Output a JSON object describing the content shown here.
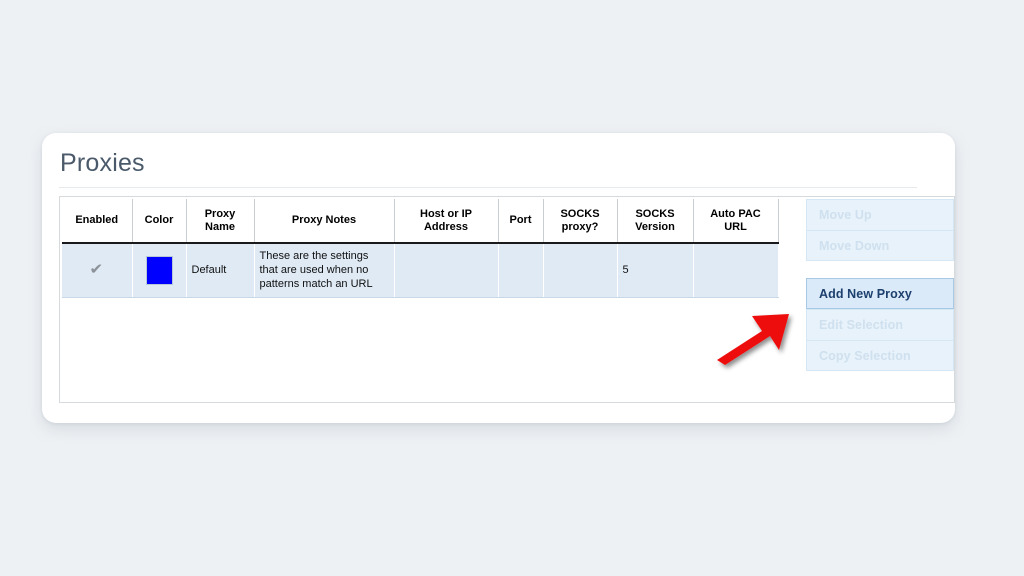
{
  "page": {
    "background_color": "#eef1f4",
    "card_background": "#ffffff"
  },
  "header": {
    "title": "Proxies",
    "title_color": "#4b5a6b"
  },
  "table": {
    "columns": [
      {
        "key": "enabled",
        "label": "Enabled"
      },
      {
        "key": "color",
        "label": "Color"
      },
      {
        "key": "name",
        "label": "Proxy\nName",
        "line1": "Proxy",
        "line2": "Name"
      },
      {
        "key": "notes",
        "label": "Proxy Notes"
      },
      {
        "key": "host",
        "label": "Host or IP\nAddress",
        "line1": "Host or IP",
        "line2": "Address"
      },
      {
        "key": "port",
        "label": "Port"
      },
      {
        "key": "socks",
        "label": "SOCKS\nproxy?",
        "line1": "SOCKS",
        "line2": "proxy?"
      },
      {
        "key": "socksver",
        "label": "SOCKS\nVersion",
        "line1": "SOCKS",
        "line2": "Version"
      },
      {
        "key": "pac",
        "label": "Auto PAC\nURL",
        "line1": "Auto PAC",
        "line2": "URL"
      }
    ],
    "rows": [
      {
        "enabled": "✔",
        "enabled_state": "checked",
        "color": "#0000ff",
        "name": "Default",
        "notes": "These are the settings that are used when no patterns match an URL",
        "host": "",
        "port": "",
        "socks": "",
        "socksver": "5",
        "pac": ""
      }
    ],
    "row_background": "#dfeaf5"
  },
  "buttons": {
    "group_one": [
      {
        "label": "Move Up",
        "enabled": false
      },
      {
        "label": "Move Down",
        "enabled": false
      }
    ],
    "group_two": [
      {
        "label": "Add New Proxy",
        "enabled": true
      },
      {
        "label": "Edit Selection",
        "enabled": false
      },
      {
        "label": "Copy Selection",
        "enabled": false
      }
    ],
    "enabled_text_color": "#1c3f6e",
    "disabled_text_color": "#cfe0ee"
  },
  "annotation": {
    "arrow_color": "#ee1010",
    "points_to": "Add New Proxy"
  }
}
